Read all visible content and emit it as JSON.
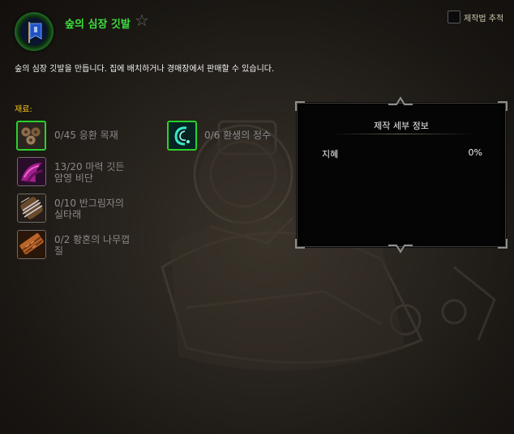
{
  "recipe": {
    "title": "숲의 심장 깃발",
    "description": "숲의 심장 깃발을 만듭니다. 집에 배치하거나 경매장에서 판매할 수 있습니다.",
    "icon": "banner-icon",
    "quality_color": "#3ee03e"
  },
  "track": {
    "label": "제작법 추적",
    "checked": false
  },
  "reagents_label": "재료:",
  "reagents": [
    {
      "text": "0/45 응환 목재",
      "icon": "lumber-icon",
      "border": "green"
    },
    {
      "text": "13/20 마력 깃든\n암영 비단",
      "icon": "shadow-silk-icon",
      "border": "grey"
    },
    {
      "text": "0/10 반그림자의\n실타래",
      "icon": "thread-spool-icon",
      "border": "grey"
    },
    {
      "text": "0/2 황혼의 나무껍\n질",
      "icon": "bark-icon",
      "border": "grey"
    },
    {
      "text": "0/6 환생의 정수",
      "icon": "essence-icon",
      "border": "green"
    }
  ],
  "details": {
    "title": "제작 세부 정보",
    "stat_name": "지혜",
    "stat_value": "0%"
  }
}
